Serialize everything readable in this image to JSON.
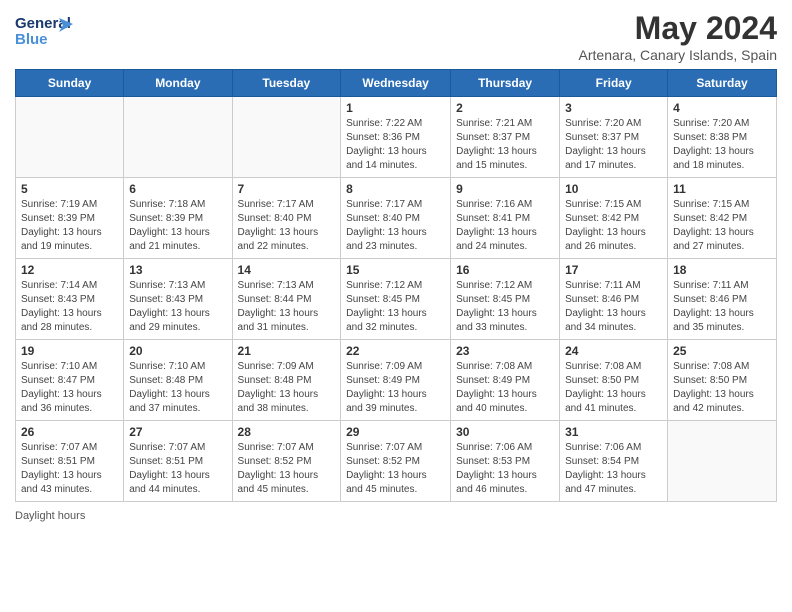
{
  "header": {
    "logo_line1": "General",
    "logo_line2": "Blue",
    "month_year": "May 2024",
    "location": "Artenara, Canary Islands, Spain"
  },
  "days_of_week": [
    "Sunday",
    "Monday",
    "Tuesday",
    "Wednesday",
    "Thursday",
    "Friday",
    "Saturday"
  ],
  "weeks": [
    [
      {
        "day": "",
        "info": ""
      },
      {
        "day": "",
        "info": ""
      },
      {
        "day": "",
        "info": ""
      },
      {
        "day": "1",
        "info": "Sunrise: 7:22 AM\nSunset: 8:36 PM\nDaylight: 13 hours and 14 minutes."
      },
      {
        "day": "2",
        "info": "Sunrise: 7:21 AM\nSunset: 8:37 PM\nDaylight: 13 hours and 15 minutes."
      },
      {
        "day": "3",
        "info": "Sunrise: 7:20 AM\nSunset: 8:37 PM\nDaylight: 13 hours and 17 minutes."
      },
      {
        "day": "4",
        "info": "Sunrise: 7:20 AM\nSunset: 8:38 PM\nDaylight: 13 hours and 18 minutes."
      }
    ],
    [
      {
        "day": "5",
        "info": "Sunrise: 7:19 AM\nSunset: 8:39 PM\nDaylight: 13 hours and 19 minutes."
      },
      {
        "day": "6",
        "info": "Sunrise: 7:18 AM\nSunset: 8:39 PM\nDaylight: 13 hours and 21 minutes."
      },
      {
        "day": "7",
        "info": "Sunrise: 7:17 AM\nSunset: 8:40 PM\nDaylight: 13 hours and 22 minutes."
      },
      {
        "day": "8",
        "info": "Sunrise: 7:17 AM\nSunset: 8:40 PM\nDaylight: 13 hours and 23 minutes."
      },
      {
        "day": "9",
        "info": "Sunrise: 7:16 AM\nSunset: 8:41 PM\nDaylight: 13 hours and 24 minutes."
      },
      {
        "day": "10",
        "info": "Sunrise: 7:15 AM\nSunset: 8:42 PM\nDaylight: 13 hours and 26 minutes."
      },
      {
        "day": "11",
        "info": "Sunrise: 7:15 AM\nSunset: 8:42 PM\nDaylight: 13 hours and 27 minutes."
      }
    ],
    [
      {
        "day": "12",
        "info": "Sunrise: 7:14 AM\nSunset: 8:43 PM\nDaylight: 13 hours and 28 minutes."
      },
      {
        "day": "13",
        "info": "Sunrise: 7:13 AM\nSunset: 8:43 PM\nDaylight: 13 hours and 29 minutes."
      },
      {
        "day": "14",
        "info": "Sunrise: 7:13 AM\nSunset: 8:44 PM\nDaylight: 13 hours and 31 minutes."
      },
      {
        "day": "15",
        "info": "Sunrise: 7:12 AM\nSunset: 8:45 PM\nDaylight: 13 hours and 32 minutes."
      },
      {
        "day": "16",
        "info": "Sunrise: 7:12 AM\nSunset: 8:45 PM\nDaylight: 13 hours and 33 minutes."
      },
      {
        "day": "17",
        "info": "Sunrise: 7:11 AM\nSunset: 8:46 PM\nDaylight: 13 hours and 34 minutes."
      },
      {
        "day": "18",
        "info": "Sunrise: 7:11 AM\nSunset: 8:46 PM\nDaylight: 13 hours and 35 minutes."
      }
    ],
    [
      {
        "day": "19",
        "info": "Sunrise: 7:10 AM\nSunset: 8:47 PM\nDaylight: 13 hours and 36 minutes."
      },
      {
        "day": "20",
        "info": "Sunrise: 7:10 AM\nSunset: 8:48 PM\nDaylight: 13 hours and 37 minutes."
      },
      {
        "day": "21",
        "info": "Sunrise: 7:09 AM\nSunset: 8:48 PM\nDaylight: 13 hours and 38 minutes."
      },
      {
        "day": "22",
        "info": "Sunrise: 7:09 AM\nSunset: 8:49 PM\nDaylight: 13 hours and 39 minutes."
      },
      {
        "day": "23",
        "info": "Sunrise: 7:08 AM\nSunset: 8:49 PM\nDaylight: 13 hours and 40 minutes."
      },
      {
        "day": "24",
        "info": "Sunrise: 7:08 AM\nSunset: 8:50 PM\nDaylight: 13 hours and 41 minutes."
      },
      {
        "day": "25",
        "info": "Sunrise: 7:08 AM\nSunset: 8:50 PM\nDaylight: 13 hours and 42 minutes."
      }
    ],
    [
      {
        "day": "26",
        "info": "Sunrise: 7:07 AM\nSunset: 8:51 PM\nDaylight: 13 hours and 43 minutes."
      },
      {
        "day": "27",
        "info": "Sunrise: 7:07 AM\nSunset: 8:51 PM\nDaylight: 13 hours and 44 minutes."
      },
      {
        "day": "28",
        "info": "Sunrise: 7:07 AM\nSunset: 8:52 PM\nDaylight: 13 hours and 45 minutes."
      },
      {
        "day": "29",
        "info": "Sunrise: 7:07 AM\nSunset: 8:52 PM\nDaylight: 13 hours and 45 minutes."
      },
      {
        "day": "30",
        "info": "Sunrise: 7:06 AM\nSunset: 8:53 PM\nDaylight: 13 hours and 46 minutes."
      },
      {
        "day": "31",
        "info": "Sunrise: 7:06 AM\nSunset: 8:54 PM\nDaylight: 13 hours and 47 minutes."
      },
      {
        "day": "",
        "info": ""
      }
    ]
  ],
  "footer": {
    "daylight_label": "Daylight hours"
  }
}
